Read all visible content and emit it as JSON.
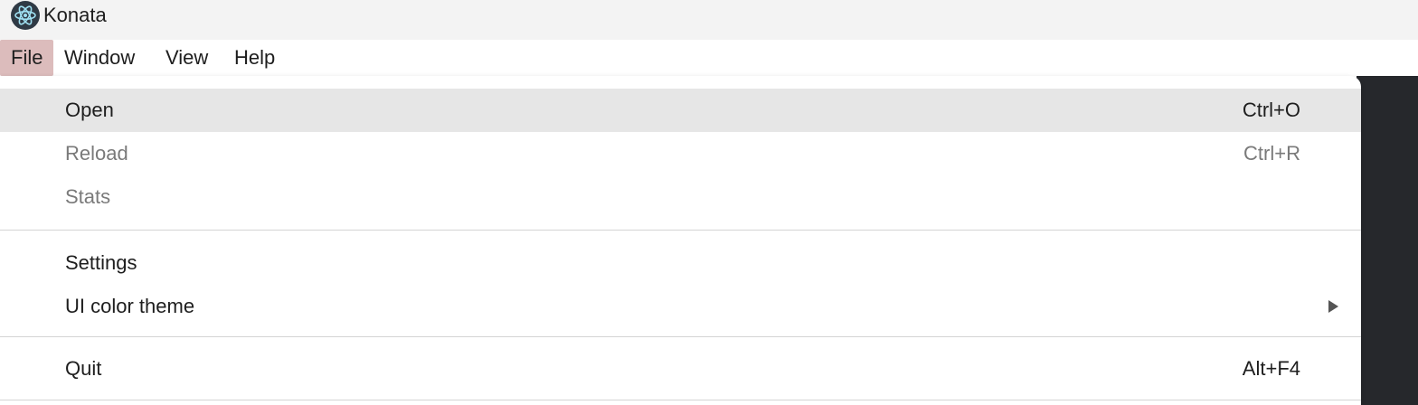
{
  "window": {
    "title": "Konata",
    "icon": "electron-atom-icon"
  },
  "menubar": {
    "items": [
      {
        "label": "File",
        "active": true
      },
      {
        "label": "Window",
        "active": false
      },
      {
        "label": "View",
        "active": false
      },
      {
        "label": "Help",
        "active": false
      }
    ]
  },
  "file_menu": {
    "items": [
      {
        "label": "Open",
        "shortcut": "Ctrl+O",
        "enabled": true,
        "highlighted": true
      },
      {
        "label": "Reload",
        "shortcut": "Ctrl+R",
        "enabled": false
      },
      {
        "label": "Stats",
        "shortcut": "",
        "enabled": false
      },
      {
        "label": "Settings",
        "shortcut": "",
        "enabled": true
      },
      {
        "label": "UI color theme",
        "shortcut": "",
        "enabled": true,
        "submenu": true,
        "submenu_icon": "submenu-arrow-icon"
      },
      {
        "label": "Quit",
        "shortcut": "Alt+F4",
        "enabled": true
      }
    ]
  },
  "colors": {
    "active_menu_bg": "#dcbcbc",
    "hover_item_bg": "#e6e6e6",
    "disabled_text": "#7a7a7a",
    "background_dark": "#26282c"
  }
}
